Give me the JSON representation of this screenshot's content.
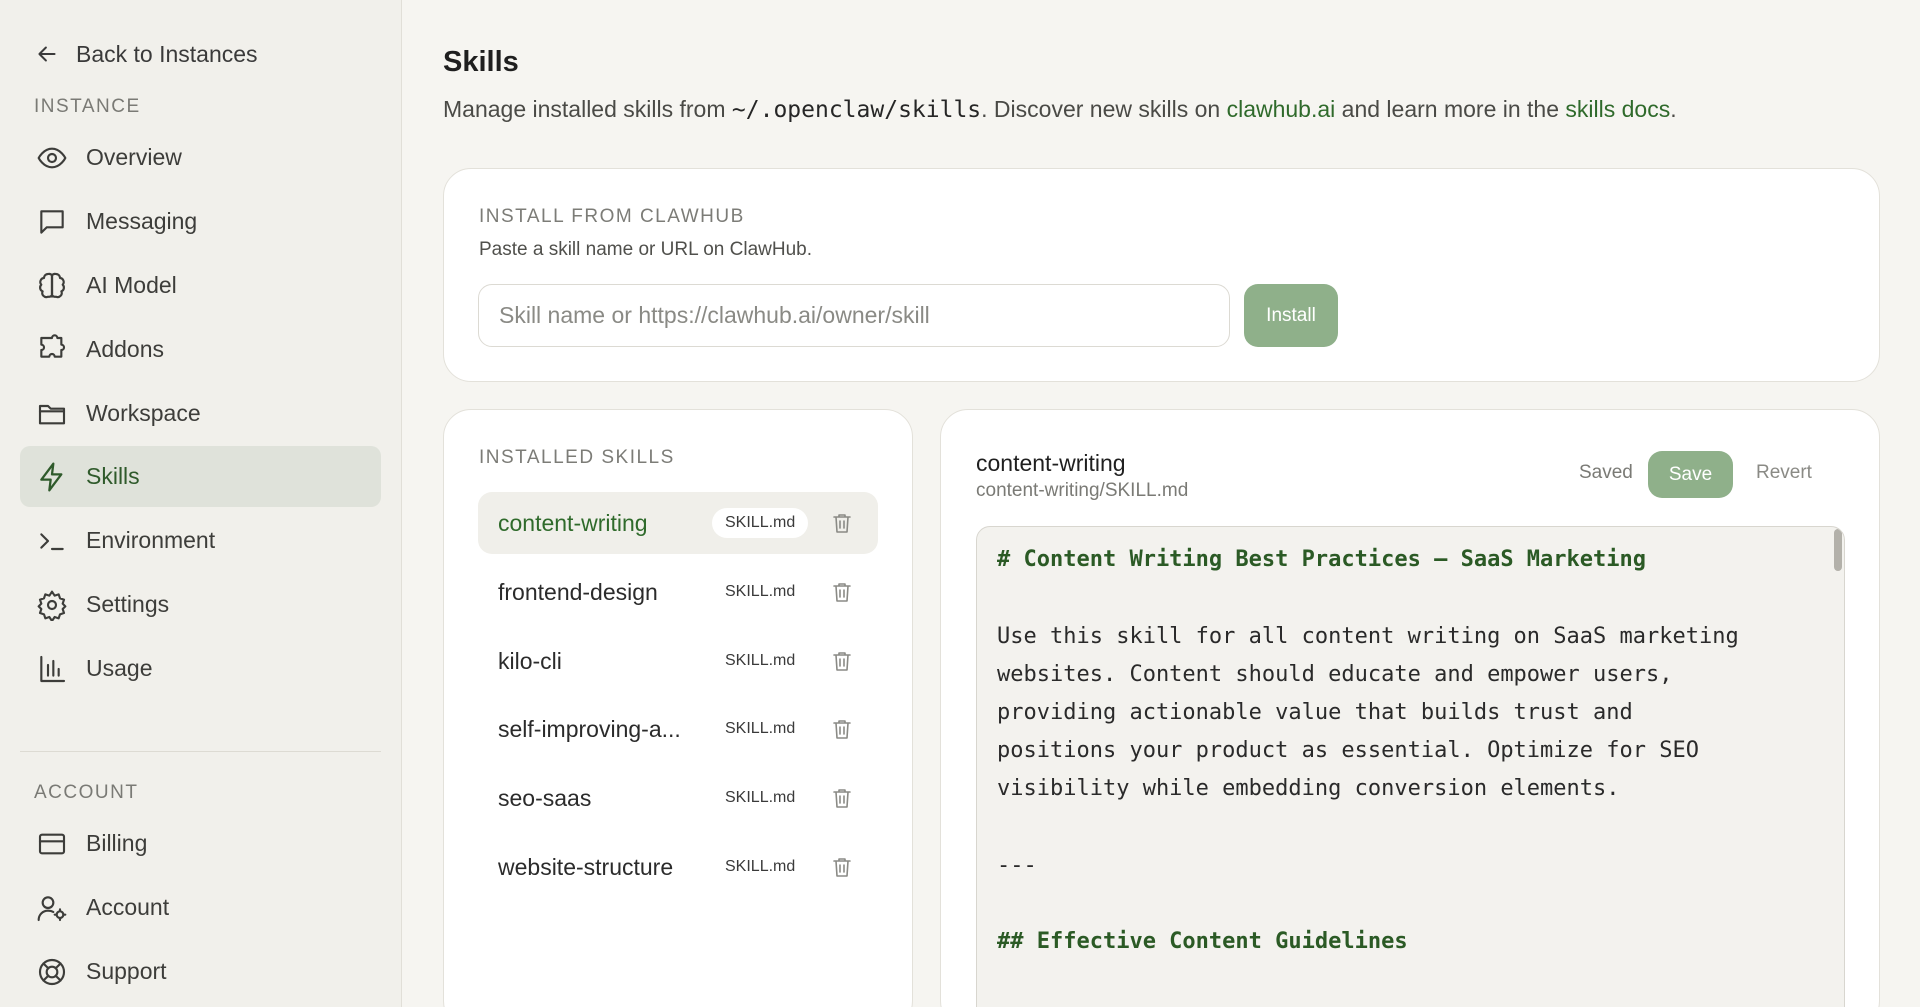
{
  "sidebar": {
    "back_label": "Back to Instances",
    "instance_section": "INSTANCE",
    "account_section": "ACCOUNT",
    "items": [
      {
        "label": "Overview",
        "icon": "eye-icon"
      },
      {
        "label": "Messaging",
        "icon": "message-icon"
      },
      {
        "label": "AI Model",
        "icon": "brain-icon"
      },
      {
        "label": "Addons",
        "icon": "puzzle-icon"
      },
      {
        "label": "Workspace",
        "icon": "folder-icon"
      },
      {
        "label": "Skills",
        "icon": "lightning-icon",
        "active": true
      },
      {
        "label": "Environment",
        "icon": "terminal-icon"
      },
      {
        "label": "Settings",
        "icon": "gear-icon"
      },
      {
        "label": "Usage",
        "icon": "bar-chart-icon"
      }
    ],
    "account_items": [
      {
        "label": "Billing",
        "icon": "credit-card-icon"
      },
      {
        "label": "Account",
        "icon": "user-gear-icon"
      },
      {
        "label": "Support",
        "icon": "lifebuoy-icon"
      }
    ]
  },
  "header": {
    "title": "Skills",
    "desc_1": "Manage installed skills from ",
    "desc_path": "~/.openclaw/skills",
    "desc_2": ". Discover new skills on ",
    "desc_link1": "clawhub.ai",
    "desc_3": " and learn more in the ",
    "desc_link2": "skills docs",
    "desc_4": "."
  },
  "install": {
    "label": "INSTALL FROM CLAWHUB",
    "subtitle": "Paste a skill name or URL on ClawHub.",
    "placeholder": "Skill name or https://clawhub.ai/owner/skill",
    "button": "Install"
  },
  "installed": {
    "label": "INSTALLED SKILLS",
    "skills": [
      {
        "name": "content-writing",
        "file": "SKILL.md",
        "active": true
      },
      {
        "name": "frontend-design",
        "file": "SKILL.md"
      },
      {
        "name": "kilo-cli",
        "file": "SKILL.md"
      },
      {
        "name": "self-improving-a...",
        "file": "SKILL.md"
      },
      {
        "name": "seo-saas",
        "file": "SKILL.md"
      },
      {
        "name": "website-structure",
        "file": "SKILL.md"
      }
    ]
  },
  "editor": {
    "title": "content-writing",
    "path": "content-writing/SKILL.md",
    "status": "Saved",
    "save": "Save",
    "revert": "Revert",
    "lines": [
      "# Content Writing Best Practices — SaaS Marketing",
      "",
      "Use this skill for all content writing on SaaS marketing",
      "websites. Content should educate and empower users,",
      "providing actionable value that builds trust and",
      "positions your product as essential. Optimize for SEO",
      "visibility while embedding conversion elements.",
      "",
      "---",
      "",
      "## Effective Content Guidelines"
    ]
  }
}
